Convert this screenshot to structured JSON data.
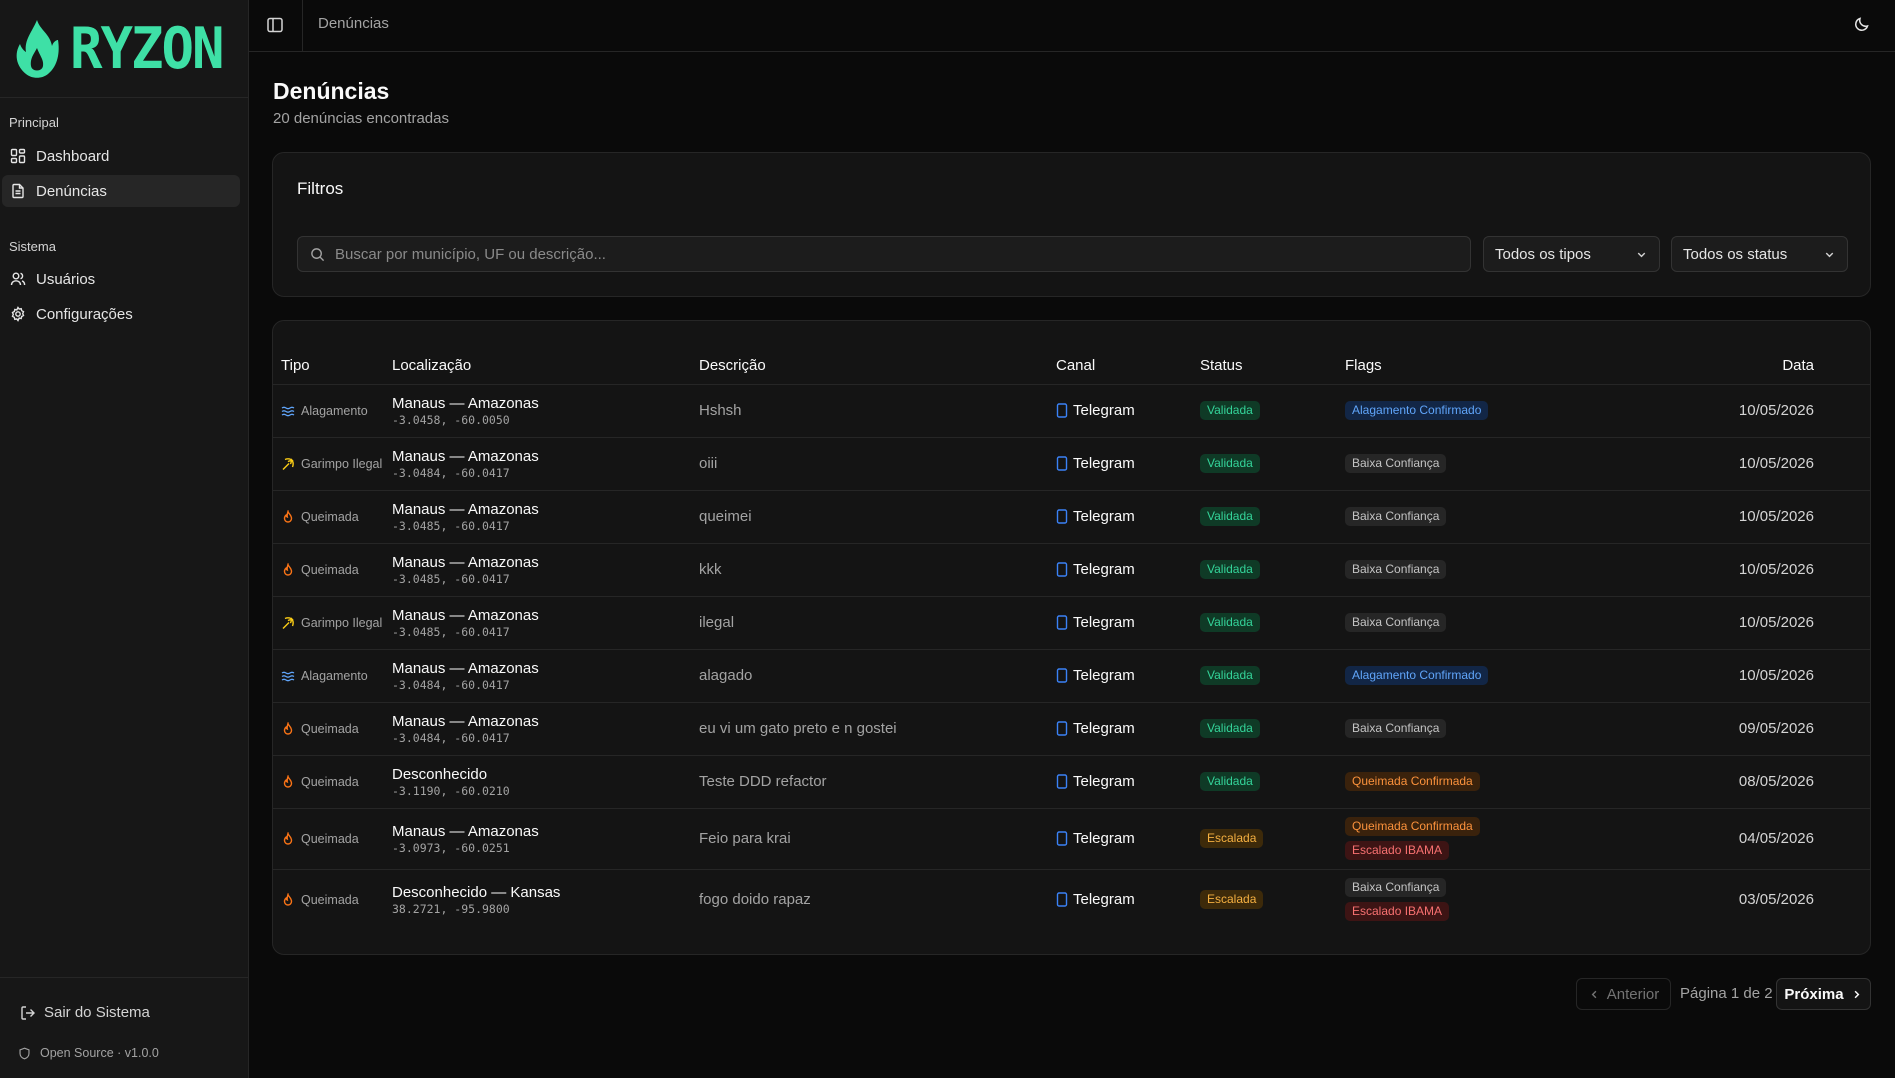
{
  "brand": {
    "name": "RYZON",
    "color": "#3ee0a6"
  },
  "sidebar": {
    "section_principal": "Principal",
    "section_sistema": "Sistema",
    "items": [
      {
        "label": "Dashboard",
        "icon": "layout-grid-icon"
      },
      {
        "label": "Denúncias",
        "icon": "file-text-icon",
        "active": true
      },
      {
        "label": "Usuários",
        "icon": "users-icon"
      },
      {
        "label": "Configurações",
        "icon": "gear-icon"
      }
    ],
    "logout": "Sair do Sistema",
    "version": "Open Source · v1.0.0"
  },
  "topbar": {
    "breadcrumb": "Denúncias"
  },
  "page": {
    "title": "Denúncias",
    "subtitle": "20 denúncias encontradas"
  },
  "filters": {
    "title": "Filtros",
    "search_placeholder": "Buscar por município, UF ou descrição...",
    "type_select": "Todos os tipos",
    "status_select": "Todos os status"
  },
  "table": {
    "headers": [
      "Tipo",
      "Localização",
      "Descrição",
      "Canal",
      "Status",
      "Flags",
      "Data"
    ],
    "rows": [
      {
        "tipo": "Alagamento",
        "loc": "Manaus — Amazonas",
        "coord": "-3.0458, -60.0050",
        "desc": "Hshsh",
        "canal": "Telegram",
        "status": "Validada",
        "flags": [
          "Alagamento Confirmado"
        ],
        "data": "10/05/2026"
      },
      {
        "tipo": "Garimpo Ilegal",
        "loc": "Manaus — Amazonas",
        "coord": "-3.0484, -60.0417",
        "desc": "oiii",
        "canal": "Telegram",
        "status": "Validada",
        "flags": [
          "Baixa Confiança"
        ],
        "data": "10/05/2026"
      },
      {
        "tipo": "Queimada",
        "loc": "Manaus — Amazonas",
        "coord": "-3.0485, -60.0417",
        "desc": "queimei",
        "canal": "Telegram",
        "status": "Validada",
        "flags": [
          "Baixa Confiança"
        ],
        "data": "10/05/2026"
      },
      {
        "tipo": "Queimada",
        "loc": "Manaus — Amazonas",
        "coord": "-3.0485, -60.0417",
        "desc": "kkk",
        "canal": "Telegram",
        "status": "Validada",
        "flags": [
          "Baixa Confiança"
        ],
        "data": "10/05/2026"
      },
      {
        "tipo": "Garimpo Ilegal",
        "loc": "Manaus — Amazonas",
        "coord": "-3.0485, -60.0417",
        "desc": "ilegal",
        "canal": "Telegram",
        "status": "Validada",
        "flags": [
          "Baixa Confiança"
        ],
        "data": "10/05/2026"
      },
      {
        "tipo": "Alagamento",
        "loc": "Manaus — Amazonas",
        "coord": "-3.0484, -60.0417",
        "desc": "alagado",
        "canal": "Telegram",
        "status": "Validada",
        "flags": [
          "Alagamento Confirmado"
        ],
        "data": "10/05/2026"
      },
      {
        "tipo": "Queimada",
        "loc": "Manaus — Amazonas",
        "coord": "-3.0484, -60.0417",
        "desc": "eu vi um gato preto e n gostei",
        "canal": "Telegram",
        "status": "Validada",
        "flags": [
          "Baixa Confiança"
        ],
        "data": "09/05/2026"
      },
      {
        "tipo": "Queimada",
        "loc": "Desconhecido",
        "coord": "-3.1190, -60.0210",
        "desc": "Teste DDD refactor",
        "canal": "Telegram",
        "status": "Validada",
        "flags": [
          "Queimada Confirmada"
        ],
        "data": "08/05/2026"
      },
      {
        "tipo": "Queimada",
        "loc": "Manaus — Amazonas",
        "coord": "-3.0973, -60.0251",
        "desc": "Feio para krai",
        "canal": "Telegram",
        "status": "Escalada",
        "flags": [
          "Queimada Confirmada",
          "Escalado IBAMA"
        ],
        "data": "04/05/2026"
      },
      {
        "tipo": "Queimada",
        "loc": "Desconhecido — Kansas",
        "coord": "38.2721, -95.9800",
        "desc": "fogo doido rapaz",
        "canal": "Telegram",
        "status": "Escalada",
        "flags": [
          "Baixa Confiança",
          "Escalado IBAMA"
        ],
        "data": "03/05/2026"
      }
    ]
  },
  "pagination": {
    "prev": "Anterior",
    "info": "Página 1 de 2",
    "next": "Próxima"
  }
}
